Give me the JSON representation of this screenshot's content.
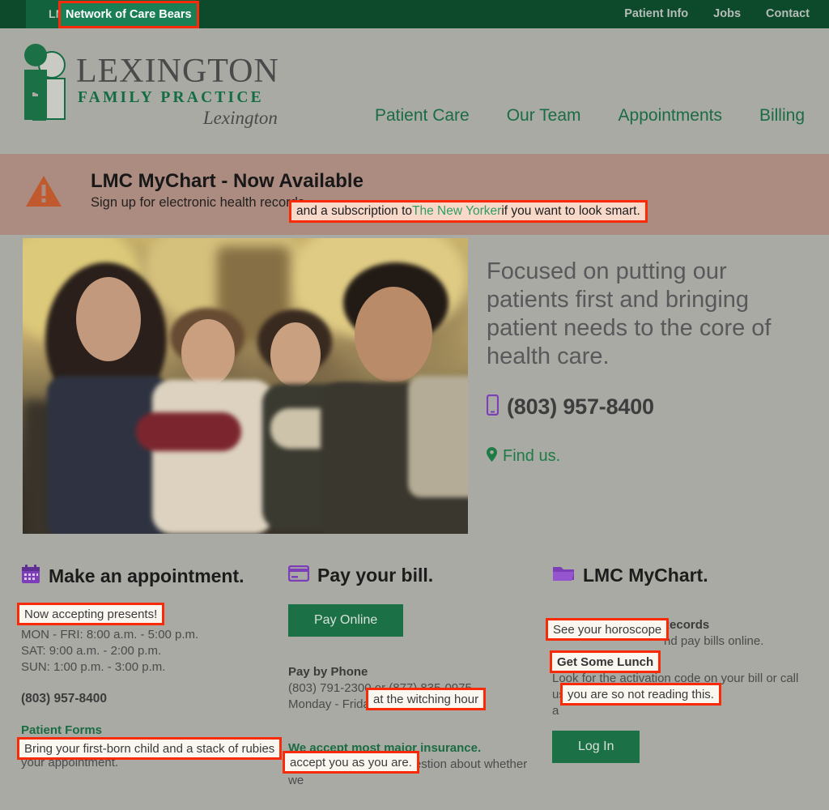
{
  "topbar": {
    "brand": "LMC",
    "nav": [
      {
        "label": "Patient Info"
      },
      {
        "label": "Jobs"
      },
      {
        "label": "Contact"
      }
    ]
  },
  "logo": {
    "line1": "LEXINGTON",
    "line2": "FAMILY PRACTICE",
    "line3": "Lexington"
  },
  "mainnav": [
    {
      "label": "Patient Care"
    },
    {
      "label": "Our Team"
    },
    {
      "label": "Appointments"
    },
    {
      "label": "Billing"
    }
  ],
  "alert": {
    "title": "LMC MyChart - Now Available",
    "subtitle": "Sign up for electronic health records"
  },
  "hero": {
    "headline": "Focused on putting our patients first and bringing patient needs to the core of health care.",
    "phone": "(803) 957-8400",
    "find_us": "Find us."
  },
  "columns": {
    "appointment": {
      "title": "Make an appointment.",
      "hours": [
        "MON - FRI: 8:00 a.m. - 5:00 p.m.",
        "SAT: 9:00 a.m. - 2:00 p.m.",
        "SUN: 1:00 p.m. - 3:00 p.m."
      ],
      "phone": "(803) 957-8400",
      "forms_heading": "Patient Forms",
      "forms_text_tail": "o",
      "forms_text_line2": "your appointment."
    },
    "bill": {
      "title": "Pay your bill.",
      "pay_online_button": "Pay Online",
      "pay_by_phone_heading": "Pay by Phone",
      "phones": "(803) 791-2300 or (877) 835-0975",
      "days": "Monday - Friday",
      "insurance_heading": "We accept most major insurance.",
      "insurance_line1": "Call us if you have a question about whether we"
    },
    "mychart": {
      "title": "LMC MyChart.",
      "records_heading": "View Your Medical Records",
      "records_tail": "nd pay bills online.",
      "activation_line": "Look for the activation code on your bill or call us",
      "activation_tail": "a",
      "login_button": "Log In"
    }
  },
  "overlays": {
    "care_bears": "Network of Care Bears",
    "new_yorker_pre": "and a subscription to ",
    "new_yorker_link": "The New Yorker",
    "new_yorker_post": " if you want to look smart.",
    "presents": "Now accepting presents!",
    "firstborn": "Bring your first-born child and a stack of rubies",
    "witching_hour": "at the witching hour",
    "as_you_are": "accept you as you are.",
    "horoscope": "See your horoscope",
    "lunch": "Get Some Lunch",
    "not_reading": "you are so not reading this."
  },
  "colors": {
    "topbar_green": "#0d4a2c",
    "brand_green": "#146c43",
    "button_green": "#1b7046",
    "alert_bg": "#ac8b80",
    "alert_icon": "#c05a2e",
    "purple_icon": "#7d3fb8",
    "page_bg": "#a9aaa4",
    "annotation_red": "#f92a08"
  }
}
